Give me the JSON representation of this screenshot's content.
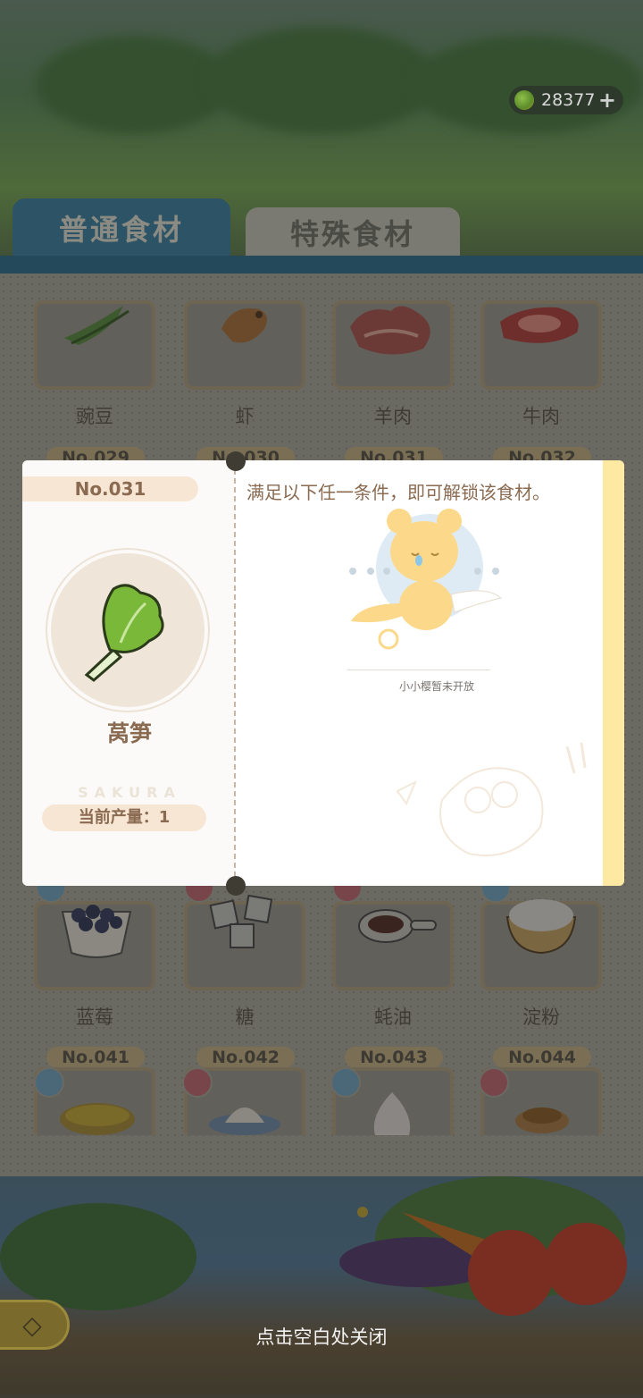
{
  "header": {
    "currency": {
      "value": "28377",
      "plus_label": "+",
      "icon": "coin-icon"
    }
  },
  "tabs": [
    {
      "label": "普通食材",
      "active": true
    },
    {
      "label": "特殊食材",
      "active": false
    }
  ],
  "grid": {
    "row1": [
      {
        "name": "豌豆",
        "icon": "pea-pod-icon"
      },
      {
        "name": "虾",
        "icon": "shrimp-icon"
      },
      {
        "name": "羊肉",
        "icon": "lamb-meat-icon"
      },
      {
        "name": "牛肉",
        "icon": "beef-icon"
      }
    ],
    "row2_numbers": [
      "No.029",
      "No.030",
      "No.031",
      "No.032"
    ],
    "row3": [
      {
        "name": "蓝莓",
        "icon": "blueberry-bowl-icon"
      },
      {
        "name": "糖",
        "icon": "sugar-cubes-icon"
      },
      {
        "name": "蚝油",
        "icon": "oyster-sauce-icon"
      },
      {
        "name": "淀粉",
        "icon": "starch-bowl-icon"
      }
    ],
    "row4": [
      {
        "no": "No.041",
        "icon": "corn-bowl-icon",
        "badge": "blue"
      },
      {
        "no": "No.042",
        "icon": "dumpling-plate-icon",
        "badge": "red"
      },
      {
        "no": "No.043",
        "icon": "garlic-icon",
        "badge": "blue"
      },
      {
        "no": "No.044",
        "icon": "sauce-bowl-icon",
        "badge": "red"
      }
    ]
  },
  "modal": {
    "number": "No.031",
    "item_name": "莴笋",
    "brand": "SAKURA",
    "production": "当前产量：1",
    "condition_text": "满足以下任一条件，即可解锁该食材。",
    "unopened_text": "小小樱暂未开放",
    "item_icon": "lettuce-icon",
    "mascot_icon": "kero-mascot-icon",
    "colors": {
      "accent": "#8a6b52",
      "stripe": "#fde9a2",
      "tag": "#f8e6d5"
    }
  },
  "footer": {
    "close_hint": "点击空白处关闭",
    "back_icon": "back-arrow-icon"
  }
}
